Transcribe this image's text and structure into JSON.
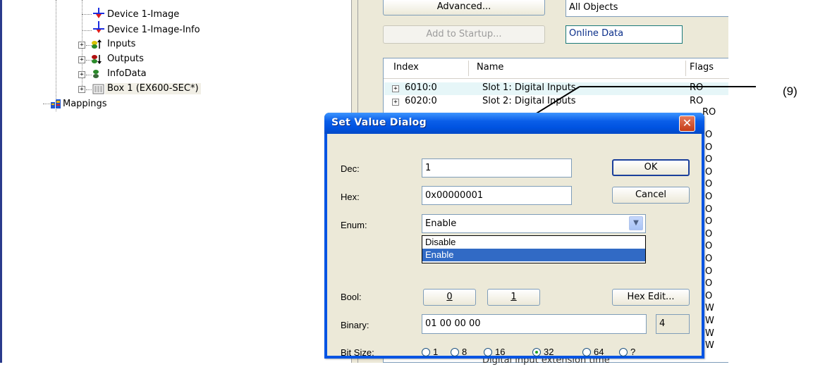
{
  "tree": {
    "items": [
      {
        "label": "Device 1-Image",
        "icon": "image-arrow-icon"
      },
      {
        "label": "Device 1-Image-Info",
        "icon": "image-arrow-icon"
      },
      {
        "label": "Inputs",
        "icon": "inputs-icon"
      },
      {
        "label": "Outputs",
        "icon": "outputs-icon"
      },
      {
        "label": "InfoData",
        "icon": "infodata-icon"
      },
      {
        "label": "Box 1 (EX600-SEC*)",
        "icon": "box-icon"
      },
      {
        "label": "Mappings",
        "icon": "mappings-icon"
      }
    ]
  },
  "panel": {
    "advanced_label": "Advanced...",
    "all_objects": "All Objects",
    "add_startup_label": "Add to Startup...",
    "online_data": "Online Data",
    "columns": [
      "Index",
      "Name",
      "Flags"
    ],
    "rows": [
      {
        "index": "6010:0",
        "name": "Slot 1: Digital Inputs",
        "flags": "RO"
      },
      {
        "index": "6020:0",
        "name": "Slot 2: Digital Inputs",
        "flags": "RO"
      },
      {
        "index": "",
        "name": "",
        "flags": "RO"
      }
    ],
    "flag_chars": [
      "O",
      "O",
      "O",
      "O",
      "O",
      "O",
      "O",
      "O",
      "O",
      "O",
      "O",
      "O",
      "O",
      "O",
      "W",
      "W",
      "W",
      "W"
    ],
    "bottom_partial": "Digital input extension time"
  },
  "callout": "(9)",
  "dialog": {
    "title": "Set Value Dialog",
    "close_glyph": "✕",
    "dec_label": "Dec:",
    "dec_value": "1",
    "hex_label": "Hex:",
    "hex_value": "0x00000001",
    "enum_label": "Enum:",
    "enum_value": "Enable",
    "enum_options": [
      "Disable",
      "Enable"
    ],
    "bool_label": "Bool:",
    "bool_0": "0",
    "bool_1": "1",
    "hex_edit": "Hex Edit...",
    "ok": "OK",
    "cancel": "Cancel",
    "binary_label": "Binary:",
    "binary_value": "01 00 00 00",
    "binary_size": "4",
    "bitsize_label": "Bit Size:",
    "bitsize_options": [
      "1",
      "8",
      "16",
      "32",
      "64",
      "?"
    ],
    "bitsize_selected": "32"
  }
}
